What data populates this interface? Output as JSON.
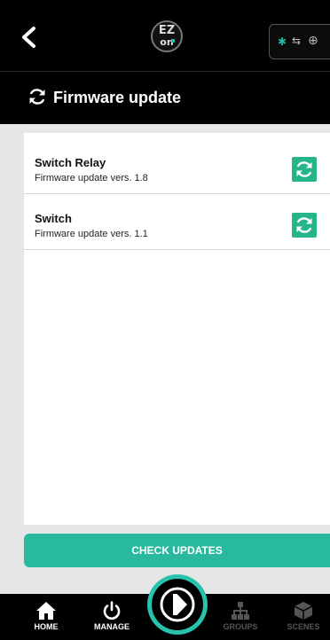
{
  "header": {
    "logo_line1": "EZ",
    "logo_line2": "on",
    "bluetooth_icon": "bluetooth-icon",
    "transfer_icon": "transfer-icon",
    "globe_icon": "globe-icon"
  },
  "page": {
    "title": "Firmware update"
  },
  "devices": [
    {
      "name": "Switch Relay",
      "description": "Firmware update vers. 1.8"
    },
    {
      "name": "Switch",
      "description": "Firmware update vers. 1.1"
    }
  ],
  "actions": {
    "check_updates": "CHECK UPDATES"
  },
  "nav": {
    "items": [
      {
        "label": "HOME",
        "active": true
      },
      {
        "label": "MANAGE",
        "active": true
      },
      {
        "label": "GROUPS",
        "active": false
      },
      {
        "label": "SCENES",
        "active": false
      }
    ]
  },
  "colors": {
    "accent": "#29b99e",
    "icon_button": "#25b58b",
    "background": "#e6e6e6",
    "bar": "#000000"
  }
}
